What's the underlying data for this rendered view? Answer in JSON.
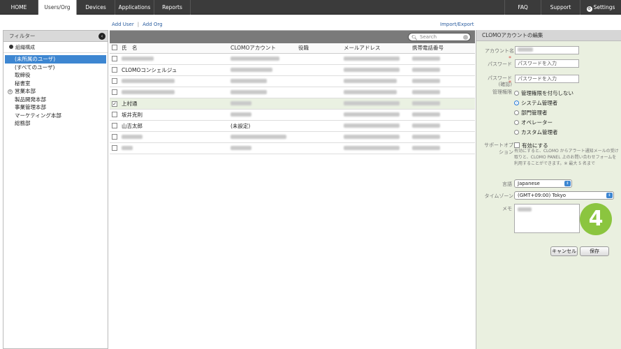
{
  "topnav": {
    "tabs": [
      {
        "label": "HOME",
        "active": false
      },
      {
        "label": "Users/Org",
        "active": true
      },
      {
        "label": "Devices",
        "active": false
      },
      {
        "label": "Applications",
        "active": false
      },
      {
        "label": "Reports",
        "active": false
      }
    ],
    "faq": "FAQ",
    "support": "Support",
    "settings": "Settings"
  },
  "sublinks": {
    "add_user": "Add User",
    "separator": "|",
    "add_org": "Add Org",
    "import_export": "Import/Export"
  },
  "filter": {
    "title": "フィルター",
    "org_header": "組織構成",
    "items": [
      {
        "label": "(未所属のユーザ)",
        "selected": true,
        "expandable": false
      },
      {
        "label": "(すべてのユーザ)",
        "selected": false,
        "expandable": false
      },
      {
        "label": "取締役",
        "selected": false,
        "expandable": false
      },
      {
        "label": "秘書室",
        "selected": false,
        "expandable": false
      },
      {
        "label": "営業本部",
        "selected": false,
        "expandable": true
      },
      {
        "label": "製品開発本部",
        "selected": false,
        "expandable": false
      },
      {
        "label": "事業管理本部",
        "selected": false,
        "expandable": false
      },
      {
        "label": "マーケティング本部",
        "selected": false,
        "expandable": false
      },
      {
        "label": "総務部",
        "selected": false,
        "expandable": false
      }
    ]
  },
  "search": {
    "placeholder": "Search"
  },
  "table": {
    "columns": [
      "氏　名",
      "CLOMOアカウント",
      "役職",
      "メールアドレス",
      "携帯電話番号"
    ],
    "rows": [
      {
        "name": "",
        "account": "",
        "checked": false
      },
      {
        "name": "CLOMOコンシェルジュ",
        "account": "",
        "checked": false
      },
      {
        "name": "",
        "account": "",
        "checked": false
      },
      {
        "name": "",
        "account": "",
        "checked": false
      },
      {
        "name": "上村通",
        "account": "",
        "checked": true
      },
      {
        "name": "坂井克則",
        "account": "",
        "checked": false
      },
      {
        "name": "山吉太郎",
        "account": "(未設定)",
        "checked": false
      },
      {
        "name": "",
        "account": "",
        "checked": false
      },
      {
        "name": "",
        "account": "",
        "checked": false
      }
    ]
  },
  "editor": {
    "title": "CLOMOアカウントの編集",
    "account_label": "アカウント名",
    "password_label": "パスワード",
    "password_placeholder": "パスワードを入力",
    "password_confirm_label_1": "パスワード",
    "password_confirm_label_2": "(確認)",
    "password_confirm_placeholder": "パスワードを入力",
    "role_label": "管理権限",
    "roles": [
      {
        "label": "管理権限を付与しない",
        "selected": false
      },
      {
        "label": "システム管理者",
        "selected": true
      },
      {
        "label": "部門管理者",
        "selected": false
      },
      {
        "label": "オペレーター",
        "selected": false
      },
      {
        "label": "カスタム管理者",
        "selected": false
      }
    ],
    "support_label_1": "サポートオプ",
    "support_label_2": "ション",
    "support_enable": "有効にする",
    "support_desc": "有効にすると、CLOMO からアラート通知メールの受け取りと、CLOMO PANEL 上のお問い合わせフォームを利用することができます。※ 最大 5 名まで",
    "language_label": "言語",
    "language_value": "Japanese",
    "timezone_label": "タイムゾーン",
    "timezone_value": "(GMT+09:00) Tokyo",
    "memo_label": "メモ",
    "cancel": "キャンセル",
    "save": "保存"
  },
  "step_badge": "4"
}
